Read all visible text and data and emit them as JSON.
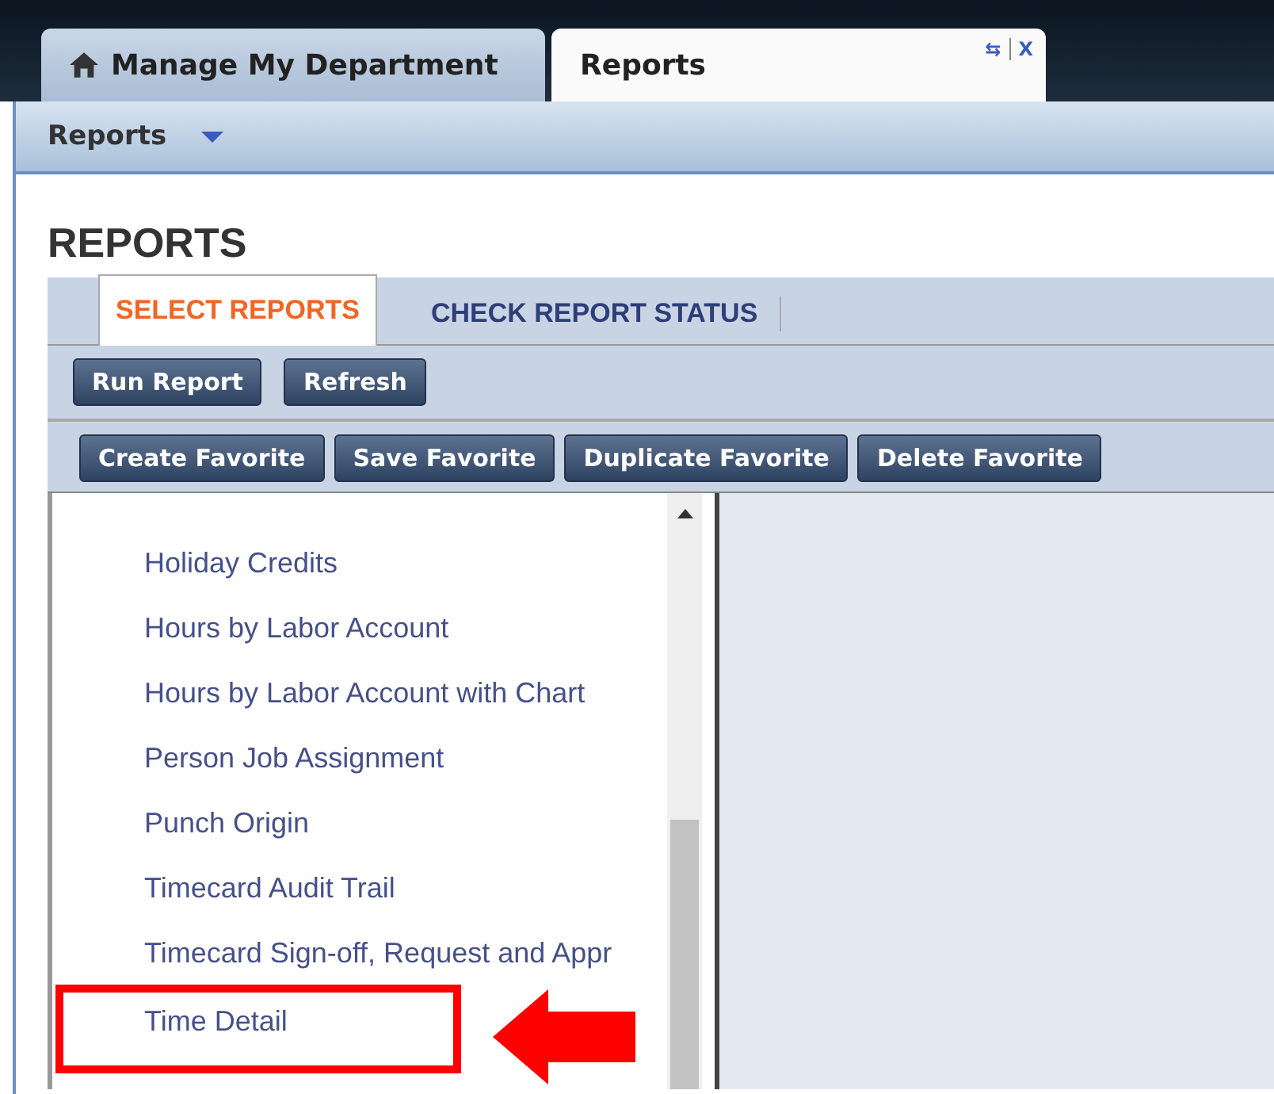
{
  "app_tabs": [
    {
      "label": "Manage My Department",
      "selected": false,
      "kind": "home"
    },
    {
      "label": "Reports",
      "selected": true,
      "kind": "page"
    }
  ],
  "app_tab_actions": [
    "⇆",
    "X"
  ],
  "menu_bar": {
    "label": "Reports"
  },
  "page_title": "REPORTS",
  "section_tabs": [
    {
      "label": "SELECT REPORTS",
      "selected": true
    },
    {
      "label": "CHECK REPORT STATUS",
      "selected": false
    }
  ],
  "action_buttons": [
    "Run Report",
    "Refresh"
  ],
  "favorite_buttons": [
    "Create Favorite",
    "Save Favorite",
    "Duplicate Favorite",
    "Delete Favorite"
  ],
  "report_list": [
    {
      "label": "Holiday Credits",
      "highlighted": false
    },
    {
      "label": "Hours by Labor Account",
      "highlighted": false
    },
    {
      "label": "Hours by Labor Account with Chart",
      "highlighted": false
    },
    {
      "label": "Person Job Assignment",
      "highlighted": false
    },
    {
      "label": "Punch Origin",
      "highlighted": false
    },
    {
      "label": "Timecard Audit Trail",
      "highlighted": false
    },
    {
      "label": "Timecard Sign-off, Request and Appr",
      "highlighted": false
    },
    {
      "label": "Time Detail",
      "highlighted": true
    }
  ]
}
